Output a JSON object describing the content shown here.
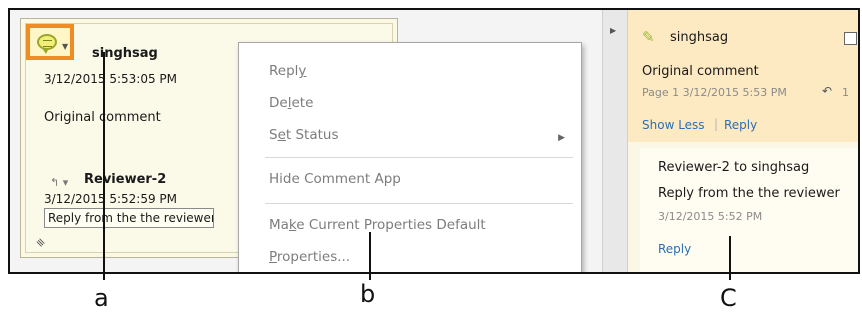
{
  "note": {
    "author": "singhsag",
    "date": "3/12/2015 5:53:05 PM",
    "text": "Original comment",
    "reply_author": "Reviewer-2",
    "reply_date": "3/12/2015 5:52:59 PM",
    "reply_text": "Reply from the the reviewer"
  },
  "menu": {
    "items": [
      {
        "label": "Reply",
        "mnemonic_index": 4
      },
      {
        "label": "Delete",
        "mnemonic_index": 2
      },
      {
        "label": "Set Status",
        "mnemonic_index": 1,
        "submenu": true
      },
      {
        "label": "Hide Comment App"
      },
      {
        "label": "Make Current Properties Default",
        "mnemonic_index": 2
      },
      {
        "label": "Properties...",
        "mnemonic_index": 0
      }
    ]
  },
  "pane": {
    "author": "singhsag",
    "text": "Original comment",
    "meta": "Page 1  3/12/2015  5:53 PM",
    "reply_count": "1",
    "show_less": "Show Less",
    "reply_link": "Reply",
    "reply_header": "Reviewer-2 to singhsag",
    "reply_text": "Reply from the the reviewer",
    "reply_meta": "3/12/2015  5:52 PM",
    "reply_link2": "Reply"
  },
  "callouts": {
    "a": "a",
    "b": "b",
    "c": "C"
  },
  "colors": {
    "highlight": "#ef8c24",
    "link": "#2a6fb3",
    "pane_card": "#fdeac2"
  }
}
